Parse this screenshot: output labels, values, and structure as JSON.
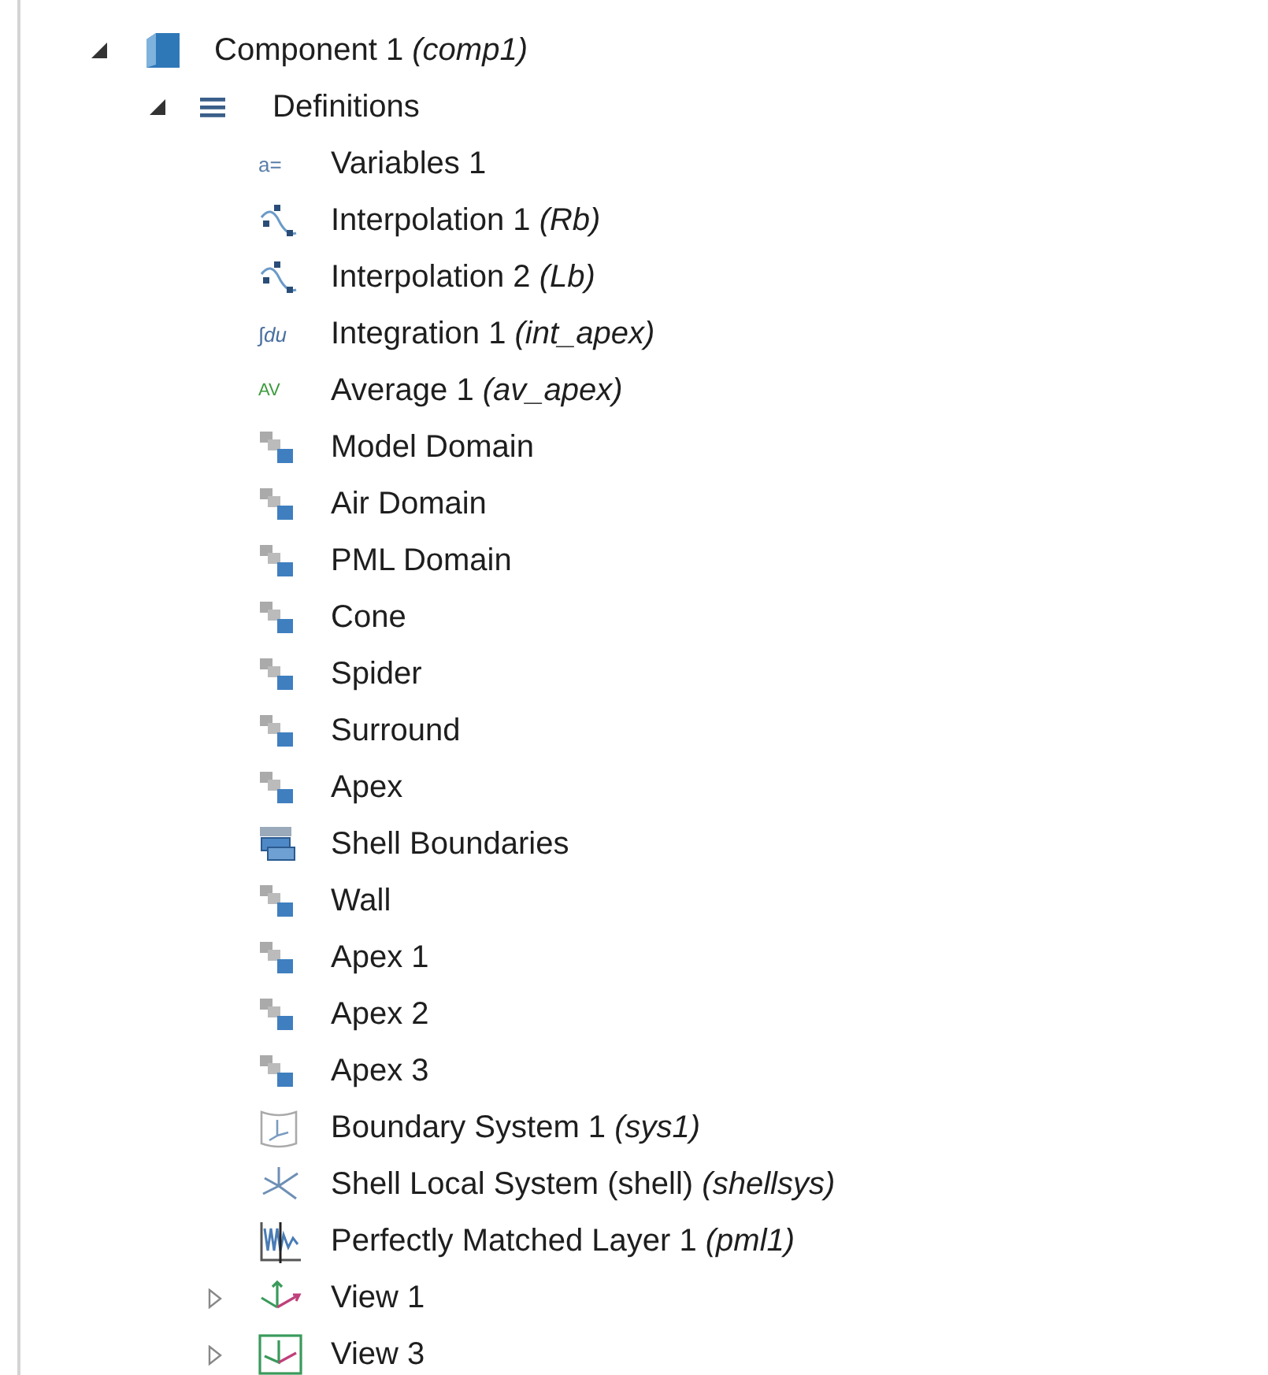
{
  "tree": [
    {
      "label": "Component 1 *(comp1)*",
      "kind": "component",
      "expanded": true,
      "children": [
        {
          "label": "Definitions",
          "kind": "definitions",
          "expanded": true,
          "children": [
            {
              "label": "Variables 1",
              "kind": "variables",
              "icon_text": "a="
            },
            {
              "label": "Interpolation 1 *(Rb)*",
              "kind": "interpolation"
            },
            {
              "label": "Interpolation 2 *(Lb)*",
              "kind": "interpolation"
            },
            {
              "label": "Integration 1 *(int_apex)*",
              "kind": "integration",
              "icon_text": "∫du"
            },
            {
              "label": "Average 1 *(av_apex)*",
              "kind": "average",
              "icon_text": "AV"
            },
            {
              "label": "Model Domain",
              "kind": "selection"
            },
            {
              "label": "Air Domain",
              "kind": "selection"
            },
            {
              "label": "PML Domain",
              "kind": "selection"
            },
            {
              "label": "Cone",
              "kind": "selection"
            },
            {
              "label": "Spider",
              "kind": "selection"
            },
            {
              "label": "Surround",
              "kind": "selection"
            },
            {
              "label": "Apex",
              "kind": "selection"
            },
            {
              "label": "Shell Boundaries",
              "kind": "boundaries"
            },
            {
              "label": "Wall",
              "kind": "selection"
            },
            {
              "label": "Apex 1",
              "kind": "selection"
            },
            {
              "label": "Apex 2",
              "kind": "selection"
            },
            {
              "label": "Apex 3",
              "kind": "selection"
            },
            {
              "label": "Boundary System 1 *(sys1)*",
              "kind": "boundary_system"
            },
            {
              "label": "Shell Local System (shell) *(shellsys)*",
              "kind": "shell_system"
            },
            {
              "label": "Perfectly Matched Layer 1 *(pml1)*",
              "kind": "pml"
            },
            {
              "label": "View 1",
              "kind": "view",
              "expanded": false
            },
            {
              "label": "View 3",
              "kind": "view_box",
              "expanded": false
            }
          ]
        }
      ]
    }
  ]
}
